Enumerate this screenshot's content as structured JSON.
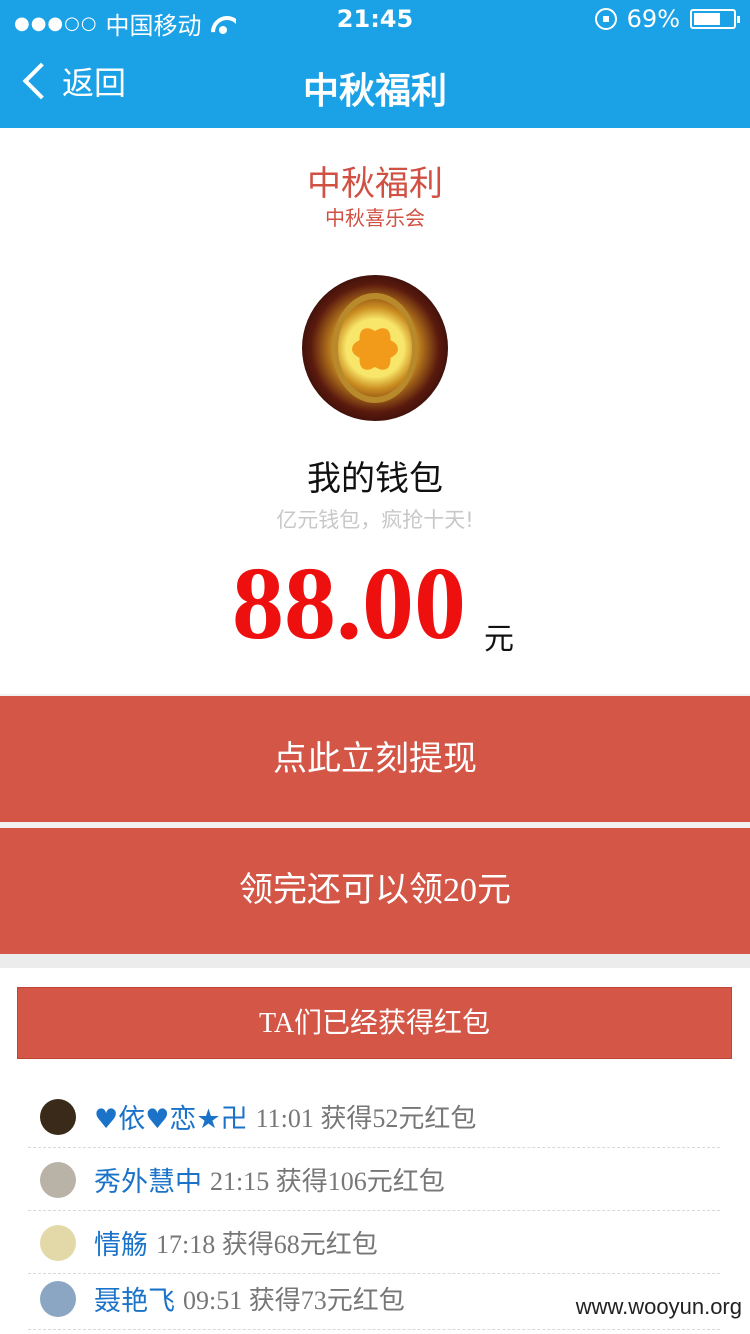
{
  "status": {
    "carrier": "中国移动",
    "signal_dots": "●●●○○",
    "time": "21:45",
    "battery": "69%",
    "battery_level": 0.69
  },
  "nav": {
    "back_label": "返回",
    "title": "中秋福利"
  },
  "header": {
    "title": "中秋福利",
    "subtitle": "中秋喜乐会"
  },
  "wallet": {
    "name": "我的钱包",
    "slogan": "亿元钱包，疯抢十天!",
    "amount": "88.00",
    "unit": "元"
  },
  "actions": {
    "withdraw_label": "点此立刻提现",
    "more_label": "领完还可以领20元"
  },
  "winners": {
    "title": "TA们已经获得红包",
    "items": [
      {
        "name": "♥依♥恋★卍",
        "time": "11:01",
        "text": "获得52元红包",
        "avatar_color": "#3a2a1a"
      },
      {
        "name": "秀外慧中",
        "time": "21:15",
        "text": "获得106元红包",
        "avatar_color": "#b9b2a6"
      },
      {
        "name": "情觞",
        "time": "17:18",
        "text": "获得68元红包",
        "avatar_color": "#e3d9a8"
      },
      {
        "name": "聂艳飞",
        "time": "09:51",
        "text": "获得73元红包",
        "avatar_color": "#8aa6c2"
      }
    ]
  },
  "watermark": "www.wooyun.org"
}
